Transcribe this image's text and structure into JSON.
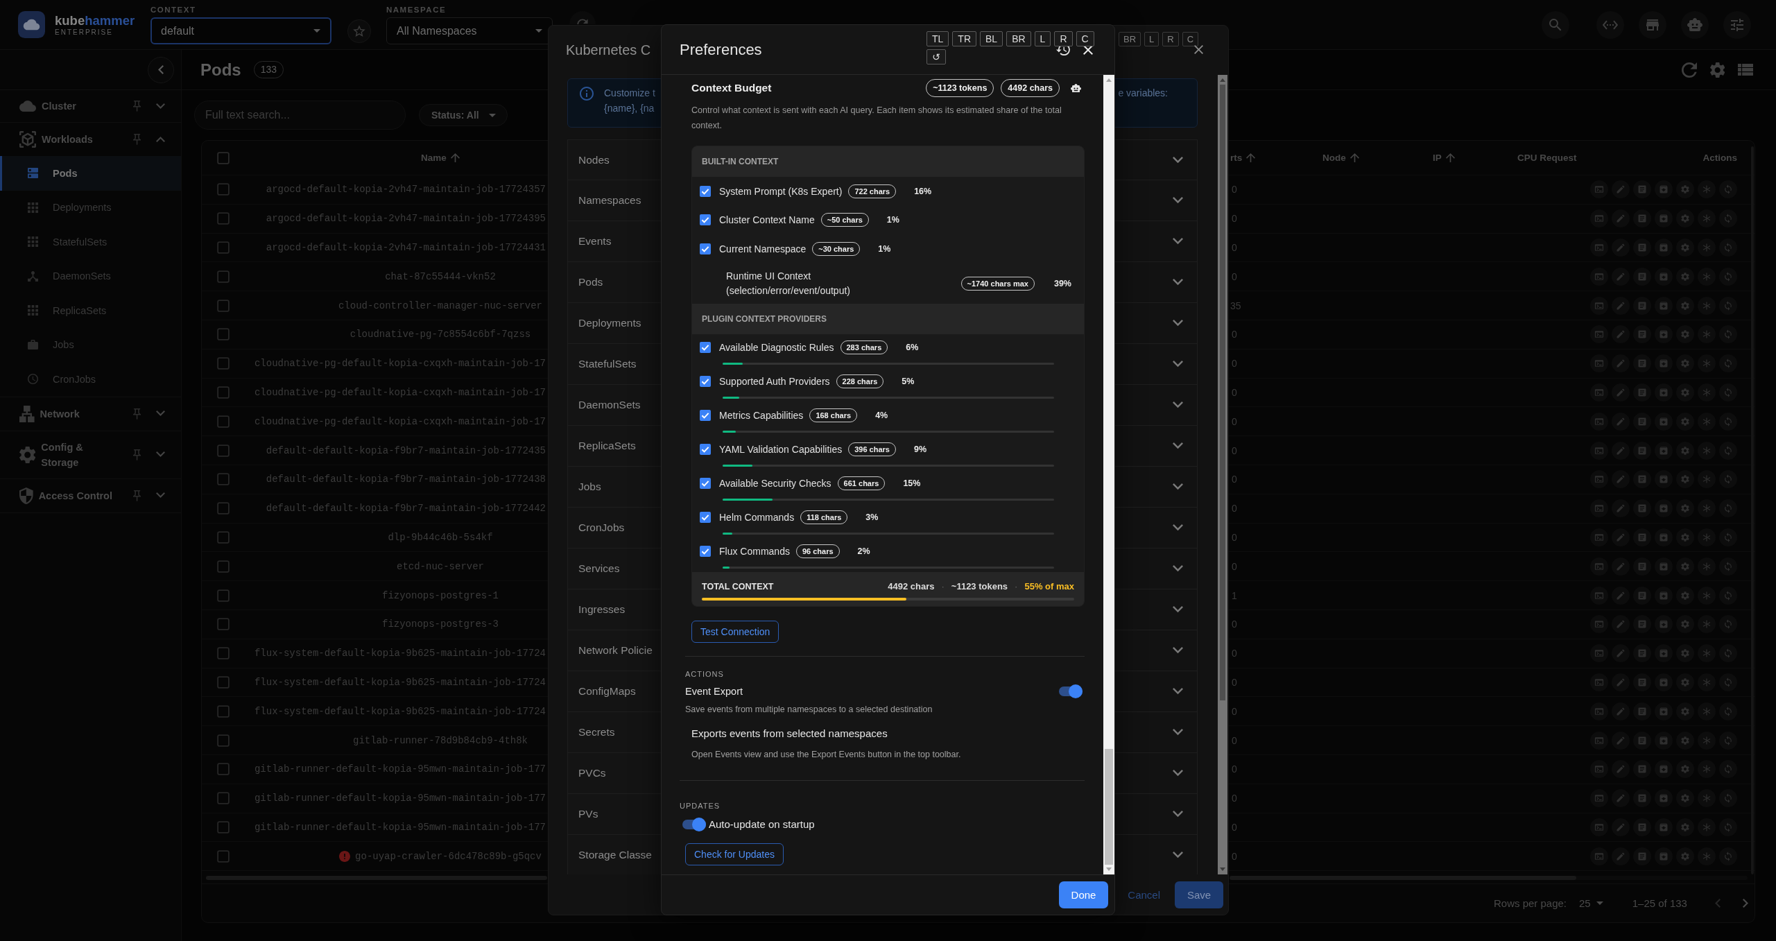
{
  "top_bar": {
    "brand": {
      "name_parts": [
        "kube",
        "hammer"
      ],
      "edition": "ENTERPRISE"
    },
    "context": {
      "label": "CONTEXT",
      "value": "default",
      "focused": true
    },
    "namespace": {
      "label": "NAMESPACE",
      "value": "All Namespaces",
      "focused": false
    }
  },
  "sidebar": {
    "sections": [
      {
        "label": "Cluster",
        "expanded": false
      },
      {
        "label": "Workloads",
        "expanded": true,
        "items": [
          {
            "label": "Pods",
            "selected": true
          },
          {
            "label": "Deployments",
            "selected": false
          },
          {
            "label": "StatefulSets",
            "selected": false
          },
          {
            "label": "DaemonSets",
            "selected": false
          },
          {
            "label": "ReplicaSets",
            "selected": false
          },
          {
            "label": "Jobs",
            "selected": false
          },
          {
            "label": "CronJobs",
            "selected": false
          }
        ]
      },
      {
        "label": "Network",
        "expanded": false
      },
      {
        "label": "Config & Storage",
        "expanded": false
      },
      {
        "label": "Access Control",
        "expanded": false
      }
    ]
  },
  "page": {
    "title": "Pods",
    "count": "133",
    "search": {
      "placeholder": "Full text search..."
    },
    "status_filter": "Status: All"
  },
  "table": {
    "select_all_checked": false,
    "columns": [
      {
        "label": "Name",
        "sortable": true
      },
      {
        "label": "rts",
        "sortable": true
      },
      {
        "label": "Node",
        "sortable": true
      },
      {
        "label": "IP",
        "sortable": true
      },
      {
        "label": "CPU Request",
        "sortable": false
      },
      {
        "label": "Actions",
        "sortable": false
      }
    ],
    "rows": [
      {
        "checked": false,
        "error": false,
        "name": "argocd-default-kopia-2vh47-maintain-job-17724357",
        "column_2": "0"
      },
      {
        "checked": false,
        "error": false,
        "name": "argocd-default-kopia-2vh47-maintain-job-17724395",
        "column_2": "0"
      },
      {
        "checked": false,
        "error": false,
        "name": "argocd-default-kopia-2vh47-maintain-job-17724431",
        "column_2": "0"
      },
      {
        "checked": false,
        "error": false,
        "name": "chat-87c55444-vkn52",
        "column_2": "0"
      },
      {
        "checked": false,
        "error": false,
        "name": "cloud-controller-manager-nuc-server",
        "column_2": "35"
      },
      {
        "checked": false,
        "error": false,
        "name": "cloudnative-pg-7c8554c6bf-7qzss",
        "column_2": "0"
      },
      {
        "checked": false,
        "error": false,
        "name": "cloudnative-pg-default-kopia-cxqxh-maintain-job-17",
        "column_2": "0"
      },
      {
        "checked": false,
        "error": false,
        "name": "cloudnative-pg-default-kopia-cxqxh-maintain-job-17",
        "column_2": "0"
      },
      {
        "checked": false,
        "error": false,
        "name": "cloudnative-pg-default-kopia-cxqxh-maintain-job-17",
        "column_2": "0"
      },
      {
        "checked": false,
        "error": false,
        "name": "default-default-kopia-f9br7-maintain-job-1772435",
        "column_2": "0"
      },
      {
        "checked": false,
        "error": false,
        "name": "default-default-kopia-f9br7-maintain-job-1772438",
        "column_2": "0"
      },
      {
        "checked": false,
        "error": false,
        "name": "default-default-kopia-f9br7-maintain-job-1772442",
        "column_2": "0"
      },
      {
        "checked": false,
        "error": false,
        "name": "dlp-9b44c46b-5s4kf",
        "column_2": "0"
      },
      {
        "checked": false,
        "error": false,
        "name": "etcd-nuc-server",
        "column_2": "0"
      },
      {
        "checked": false,
        "error": false,
        "name": "fizyonops-postgres-1",
        "column_2": "1"
      },
      {
        "checked": false,
        "error": false,
        "name": "fizyonops-postgres-3",
        "column_2": "0"
      },
      {
        "checked": false,
        "error": false,
        "name": "flux-system-default-kopia-9b625-maintain-job-17724",
        "column_2": "0"
      },
      {
        "checked": false,
        "error": false,
        "name": "flux-system-default-kopia-9b625-maintain-job-17724",
        "column_2": "0"
      },
      {
        "checked": false,
        "error": false,
        "name": "flux-system-default-kopia-9b625-maintain-job-17724",
        "column_2": "0"
      },
      {
        "checked": false,
        "error": false,
        "name": "gitlab-runner-78d9b84cb9-4th8k",
        "column_2": "0"
      },
      {
        "checked": false,
        "error": false,
        "name": "gitlab-runner-default-kopia-95mwn-maintain-job-177",
        "column_2": "0"
      },
      {
        "checked": false,
        "error": false,
        "name": "gitlab-runner-default-kopia-95mwn-maintain-job-177",
        "column_2": "0"
      },
      {
        "checked": false,
        "error": false,
        "name": "gitlab-runner-default-kopia-95mwn-maintain-job-177",
        "column_2": "0"
      },
      {
        "checked": false,
        "error": true,
        "name": "go-uyap-crawler-6dc478c89b-g5qcv",
        "column_2": "0"
      }
    ],
    "footer": {
      "rows_per_page_label": "Rows per page:",
      "rows_per_page": "25",
      "range": "1–25 of 133",
      "previous_disabled": true,
      "next_disabled": false
    }
  },
  "kubernetes_dialog": {
    "title": "Kubernetes C",
    "layout_buttons": [
      "BR",
      "L",
      "R",
      "C"
    ],
    "info": {
      "left_lines": [
        "Customize t",
        "{name}, {na"
      ],
      "right_text": "e variables:"
    },
    "sections": [
      {
        "label": "Nodes",
        "expanded": false
      },
      {
        "label": "Namespaces",
        "expanded": false
      },
      {
        "label": "Events",
        "expanded": false
      },
      {
        "label": "Pods",
        "expanded": false
      },
      {
        "label": "Deployments",
        "expanded": false
      },
      {
        "label": "StatefulSets",
        "expanded": false
      },
      {
        "label": "DaemonSets",
        "expanded": false
      },
      {
        "label": "ReplicaSets",
        "expanded": false
      },
      {
        "label": "Jobs",
        "expanded": false
      },
      {
        "label": "CronJobs",
        "expanded": false
      },
      {
        "label": "Services",
        "expanded": false
      },
      {
        "label": "Ingresses",
        "expanded": false
      },
      {
        "label": "Network Policie",
        "expanded": false
      },
      {
        "label": "ConfigMaps",
        "expanded": false
      },
      {
        "label": "Secrets",
        "expanded": false
      },
      {
        "label": "PVCs",
        "expanded": false
      },
      {
        "label": "PVs",
        "expanded": false
      },
      {
        "label": "Storage Classe",
        "expanded": false
      }
    ],
    "cancel": "Cancel",
    "save": "Save"
  },
  "preferences": {
    "title": "Preferences",
    "layout_buttons": [
      "TL",
      "TR",
      "BL",
      "BR",
      "L",
      "R",
      "C",
      "↺"
    ],
    "context_budget": {
      "title": "Context Budget",
      "tokens": "~1123 tokens",
      "chars": "4492 chars",
      "description": "Control what context is sent with each AI query. Each item shows its estimated share of the total context.",
      "groups": [
        {
          "title": "BUILT-IN CONTEXT",
          "items": [
            {
              "kind": "builtin",
              "checked": true,
              "label": "System Prompt (K8s Expert)",
              "size": "722 chars",
              "share": "16%"
            },
            {
              "kind": "builtin",
              "checked": true,
              "label": "Cluster Context Name",
              "size": "~50 chars",
              "share": "1%"
            },
            {
              "kind": "builtin",
              "checked": true,
              "label": "Current Namespace",
              "size": "~30 chars",
              "share": "1%"
            },
            {
              "kind": "info",
              "label": "Runtime UI Context (selection/error/event/output)",
              "size": "~1740 chars max",
              "share": "39%"
            }
          ]
        },
        {
          "title": "PLUGIN CONTEXT PROVIDERS",
          "items": [
            {
              "kind": "provider",
              "checked": true,
              "label": "Available Diagnostic Rules",
              "size": "283 chars",
              "share": "6%",
              "level": 0.06
            },
            {
              "kind": "provider",
              "checked": true,
              "label": "Supported Auth Providers",
              "size": "228 chars",
              "share": "5%",
              "level": 0.05
            },
            {
              "kind": "provider",
              "checked": true,
              "label": "Metrics Capabilities",
              "size": "168 chars",
              "share": "4%",
              "level": 0.04
            },
            {
              "kind": "provider",
              "checked": true,
              "label": "YAML Validation Capabilities",
              "size": "396 chars",
              "share": "9%",
              "level": 0.09
            },
            {
              "kind": "provider",
              "checked": true,
              "label": "Available Security Checks",
              "size": "661 chars",
              "share": "15%",
              "level": 0.15
            },
            {
              "kind": "provider",
              "checked": true,
              "label": "Helm Commands",
              "size": "118 chars",
              "share": "3%",
              "level": 0.03
            },
            {
              "kind": "provider",
              "checked": true,
              "label": "Flux Commands",
              "size": "96 chars",
              "share": "2%",
              "level": 0.02
            }
          ]
        }
      ],
      "total": {
        "label": "TOTAL CONTEXT",
        "summary": [
          {
            "kind": "plain",
            "text": "4492 chars"
          },
          {
            "kind": "separator",
            "text": "·"
          },
          {
            "kind": "plain",
            "text": "~1123 tokens"
          },
          {
            "kind": "separator",
            "text": "·"
          },
          {
            "kind": "highlight",
            "text": "55% of max"
          }
        ],
        "level": 0.55
      }
    },
    "test_button": "Test Connection",
    "actions": {
      "heading": "ACTIONS",
      "title": "Event Export",
      "on": true,
      "description": "Save events from multiple namespaces to a selected destination",
      "note_title": "Exports events from selected namespaces",
      "note_text": "Open Events view and use the Export Events button in the top toolbar."
    },
    "updates": {
      "heading": "UPDATES",
      "toggle_label": "Auto-update on startup",
      "on": true,
      "button": "Check for Updates"
    },
    "done": "Done"
  }
}
